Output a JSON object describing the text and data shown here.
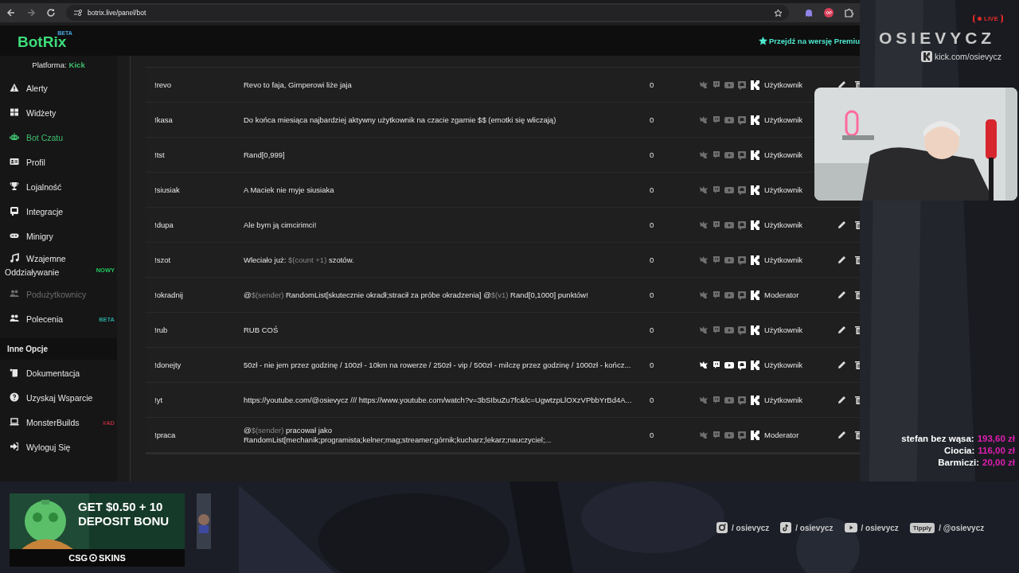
{
  "browser": {
    "url": "botrix.live/panel/bot"
  },
  "app": {
    "logo": "BotRix",
    "logo_badge": "BETA",
    "premium_link": "Przejdź na wersję Premiu"
  },
  "sidebar": {
    "platform_label": "Platforma:",
    "platform": "Kick",
    "items": [
      {
        "label": "Alerty",
        "selected": false,
        "disabled": false
      },
      {
        "label": "Widżety",
        "selected": false,
        "disabled": false
      },
      {
        "label": "Bot Czatu",
        "selected": true,
        "disabled": false
      },
      {
        "label": "Profil",
        "selected": false,
        "disabled": false
      },
      {
        "label": "Lojalność",
        "selected": false,
        "disabled": false
      },
      {
        "label": "Integracje",
        "selected": false,
        "disabled": false
      },
      {
        "label": "Minigry",
        "selected": false,
        "disabled": false
      },
      {
        "label": "Wzajemne Oddziaływanie",
        "selected": false,
        "disabled": false,
        "badge": {
          "text": "NOWY",
          "color": "#22c55e"
        }
      },
      {
        "label": "Podużytkownicy",
        "selected": false,
        "disabled": true
      },
      {
        "label": "Polecenia",
        "selected": false,
        "disabled": false,
        "badge": {
          "text": "BETA",
          "color": "#2aa198"
        }
      }
    ],
    "section_title": "Inne Opcje",
    "more_items": [
      {
        "label": "Dokumentacja"
      },
      {
        "label": "Uzyskaj Wsparcie"
      },
      {
        "label": "MonsterBuilds",
        "badge": {
          "text": "#AD",
          "color": "#b02a3c"
        }
      },
      {
        "label": "Wyloguj Się"
      }
    ]
  },
  "commands": [
    {
      "command": "!revo",
      "response": [
        {
          "text": "Revo to faja, Gimperowi liże jaja"
        }
      ],
      "count": "0",
      "platforms": [
        false,
        false,
        false,
        false,
        true
      ],
      "role": "Użytkownik"
    },
    {
      "command": "!kasa",
      "response": [
        {
          "text": "Do końca miesiąca najbardziej aktywny użytkownik na czacie zgarnie $$ (emotki się wliczają)"
        }
      ],
      "count": "0",
      "platforms": [
        false,
        false,
        false,
        false,
        true
      ],
      "role": "Użytkownik"
    },
    {
      "command": "!tst",
      "response": [
        {
          "text": "Rand[0,999]"
        }
      ],
      "count": "0",
      "platforms": [
        false,
        false,
        false,
        false,
        true
      ],
      "role": "Użytkownik"
    },
    {
      "command": "!siusiak",
      "response": [
        {
          "text": "A Maciek nie myje siusiaka"
        }
      ],
      "count": "0",
      "platforms": [
        false,
        false,
        false,
        false,
        true
      ],
      "role": "Użytkownik"
    },
    {
      "command": "!dupa",
      "response": [
        {
          "text": "Ale bym ją cimcirimci!"
        }
      ],
      "count": "0",
      "platforms": [
        false,
        false,
        false,
        false,
        true
      ],
      "role": "Użytkownik"
    },
    {
      "command": "!szot",
      "response": [
        {
          "text": "Wleciało już: "
        },
        {
          "text": "$(count +1)",
          "kind": "variable"
        },
        {
          "text": " szotów."
        }
      ],
      "count": "0",
      "platforms": [
        false,
        false,
        false,
        false,
        true
      ],
      "role": "Użytkownik"
    },
    {
      "command": "!okradnij",
      "response": [
        {
          "text": "@"
        },
        {
          "text": "$(sender)",
          "kind": "variable"
        },
        {
          "text": " RandomList[skutecznie okradł;stracił za próbe okradzenia] @"
        },
        {
          "text": "$(v1)",
          "kind": "variable"
        },
        {
          "text": " Rand[0,1000] punktów!"
        }
      ],
      "count": "0",
      "platforms": [
        false,
        false,
        false,
        false,
        true
      ],
      "role": "Moderator"
    },
    {
      "command": "!rub",
      "response": [
        {
          "text": "RUB COŚ"
        }
      ],
      "count": "0",
      "platforms": [
        false,
        false,
        false,
        false,
        true
      ],
      "role": "Użytkownik"
    },
    {
      "command": "!donejty",
      "response": [
        {
          "text": "50zł - nie jem przez godzinę / 100zł - 10km na rowerze / 250zł - vip / 500zł - milczę przez godzinę / 1000zł - kończ..."
        }
      ],
      "count": "0",
      "platforms": [
        true,
        true,
        true,
        true,
        true
      ],
      "role": "Użytkownik"
    },
    {
      "command": "!yt",
      "response": [
        {
          "text": "https://youtube.com/@osievycz /// https://www.youtube.com/watch?v=3bSIbuZu7fc&lc=UgwtzpLlOXzVPbbYrBd4A..."
        }
      ],
      "count": "0",
      "platforms": [
        false,
        false,
        false,
        false,
        true
      ],
      "role": "Użytkownik"
    },
    {
      "command": "!praca",
      "response": [
        {
          "text": "@"
        },
        {
          "text": "$(sender)",
          "kind": "variable"
        },
        {
          "text": " pracował jako RandomList[mechanik;programista;kelner;mag;streamer;górnik;kucharz;lekarz;nauczyciel;..."
        }
      ],
      "count": "0",
      "platforms": [
        false,
        false,
        false,
        false,
        true
      ],
      "role": "Moderator"
    }
  ],
  "overlay": {
    "live": "LIVE",
    "channel_name": "OSIEVYCZ",
    "channel_url": "kick.com/osievycz",
    "donations": [
      {
        "name": "stefan bez wąsa:",
        "amount": "193,60 zł"
      },
      {
        "name": "Ciocia:",
        "amount": "116,00 zł"
      },
      {
        "name": "Barmiczi:",
        "amount": "20,00 zł"
      }
    ],
    "socials": [
      {
        "kind": "instagram",
        "handle": "/ osievycz"
      },
      {
        "kind": "tiktok",
        "handle": "/ osievycz"
      },
      {
        "kind": "youtube",
        "handle": "/ osievycz"
      },
      {
        "kind": "tipply",
        "badge": "Tipply",
        "handle": "/ @osievycz"
      }
    ],
    "ad": {
      "lines": [
        "GET $0.50 + 10",
        "DEPOSIT BONU"
      ],
      "brand_left": "CSG",
      "brand_right": "SKINS"
    }
  }
}
